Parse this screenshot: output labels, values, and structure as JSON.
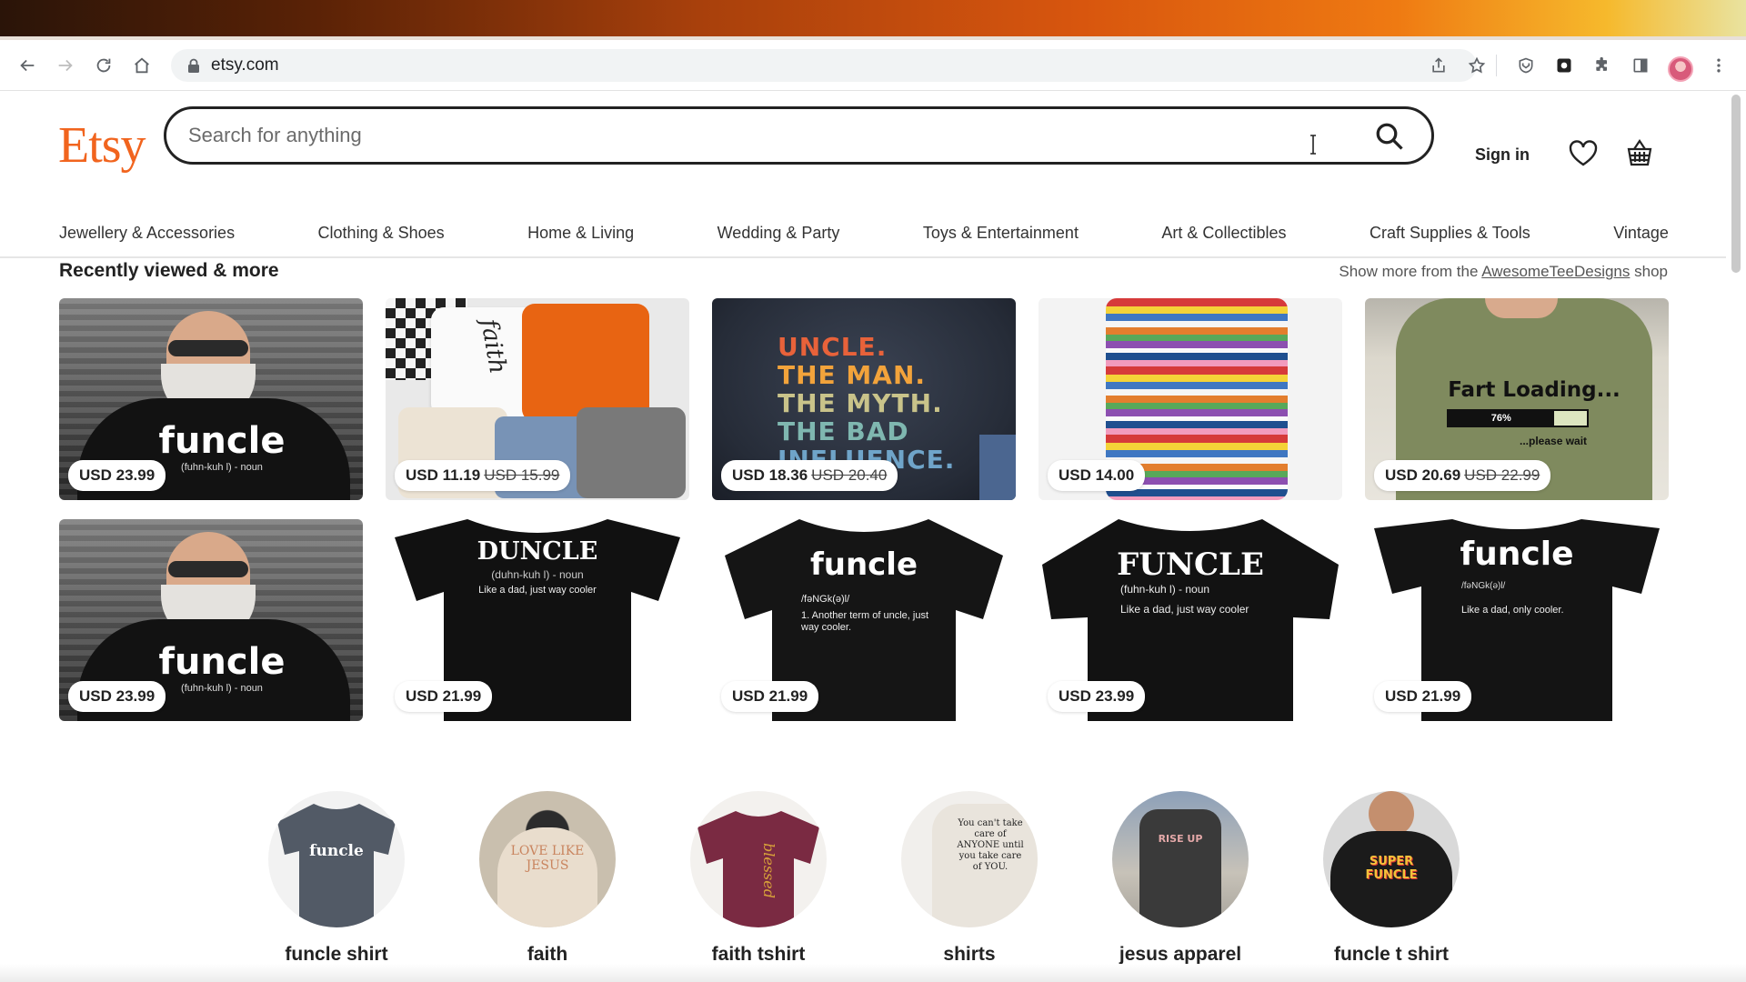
{
  "browser": {
    "url": "etsy.com"
  },
  "header": {
    "logo": "Etsy",
    "search_placeholder": "Search for anything",
    "signin_label": "Sign in"
  },
  "categories": [
    "Jewellery & Accessories",
    "Clothing & Shoes",
    "Home & Living",
    "Wedding & Party",
    "Toys & Entertainment",
    "Art & Collectibles",
    "Craft Supplies & Tools",
    "Vintage"
  ],
  "recently_viewed": {
    "title": "Recently viewed & more",
    "more_prefix": "Show more from the",
    "shop_name": "AwesomeTeeDesigns",
    "more_suffix": "shop",
    "items": [
      {
        "price": "USD 23.99",
        "original": "",
        "shirt_text": "funcle",
        "shirt_sub": "(fuhn-kuh l) - noun"
      },
      {
        "price": "USD 11.19",
        "original": "USD 15.99",
        "shirt_text": "faith",
        "shirt_sub": ""
      },
      {
        "price": "USD 18.36",
        "original": "USD 20.40",
        "shirt_text": "UNCLE. THE MAN. THE MYTH. THE BAD INFLUENCE.",
        "shirt_sub": ""
      },
      {
        "price": "USD 14.00",
        "original": "",
        "shirt_text": "",
        "shirt_sub": ""
      },
      {
        "price": "USD 20.69",
        "original": "USD 22.99",
        "shirt_text": "Fart Loading...",
        "shirt_sub": "76%",
        "shirt_sub2": "...please wait"
      },
      {
        "price": "USD 23.99",
        "original": "",
        "shirt_text": "funcle",
        "shirt_sub": "(fuhn-kuh l) - noun"
      },
      {
        "price": "USD 21.99",
        "original": "",
        "shirt_text": "DUNCLE",
        "shirt_sub": "(duhn-kuh l) - noun",
        "shirt_sub2": "Like a dad, just way cooler"
      },
      {
        "price": "USD 21.99",
        "original": "",
        "shirt_text": "funcle",
        "shirt_sub": "/fəNGk(ə)l/",
        "shirt_sub2": "1. Another term of uncle, just way cooler."
      },
      {
        "price": "USD 23.99",
        "original": "",
        "shirt_text": "FUNCLE",
        "shirt_sub": "(fuhn-kuh l) - noun",
        "shirt_sub2": "Like a dad, just way cooler"
      },
      {
        "price": "USD 21.99",
        "original": "",
        "shirt_text": "funcle",
        "shirt_sub": "/fəNGk(ə)l/",
        "shirt_sub2": "Like a dad, only cooler."
      }
    ]
  },
  "popular_searches": [
    {
      "label": "funcle shirt",
      "art": "funcle"
    },
    {
      "label": "faith",
      "art": "LOVE LIKE JESUS"
    },
    {
      "label": "faith tshirt",
      "art": "blessed"
    },
    {
      "label": "shirts",
      "art": "You can't take care of ANYONE until you take care of YOU."
    },
    {
      "label": "jesus apparel",
      "art": "RISE UP"
    },
    {
      "label": "funcle t shirt",
      "art": "SUPER FUNCLE"
    }
  ]
}
